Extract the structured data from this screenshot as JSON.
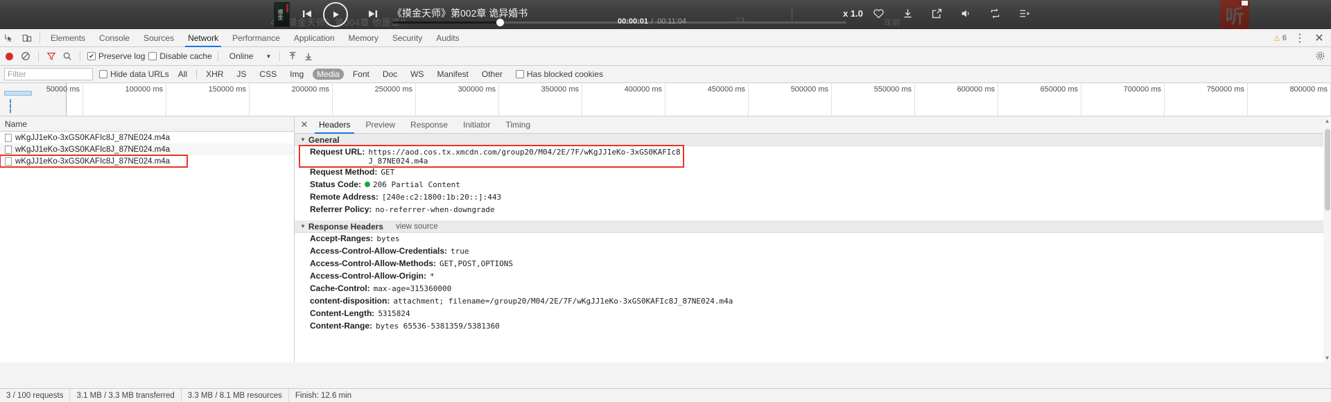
{
  "player": {
    "track_title": "《摸金天师》第002章 诡异婚书",
    "ghost_text": "4  《摸金天师》第004章 他是谁?",
    "ghost_text_2": "23",
    "ghost_text_3": "年前",
    "album_art_text": "摸金",
    "time_current": "00:00:01",
    "time_separator": "/",
    "time_duration": "00:11:04",
    "speed": "x 1.0",
    "icons": [
      "prev-icon",
      "play-icon",
      "next-icon",
      "heart-icon",
      "download-icon",
      "share-icon",
      "volume-icon",
      "repeat-icon",
      "playlist-icon"
    ],
    "logo_glyph": "听"
  },
  "devtools": {
    "tabs": [
      {
        "label": "Elements",
        "active": false
      },
      {
        "label": "Console",
        "active": false
      },
      {
        "label": "Sources",
        "active": false
      },
      {
        "label": "Network",
        "active": true
      },
      {
        "label": "Performance",
        "active": false
      },
      {
        "label": "Application",
        "active": false
      },
      {
        "label": "Memory",
        "active": false
      },
      {
        "label": "Security",
        "active": false
      },
      {
        "label": "Audits",
        "active": false
      }
    ],
    "warning_count": "6",
    "warning_icon": "⚠",
    "more_icon": "⋮",
    "close_icon": "✕"
  },
  "network_toolbar": {
    "preserve_log_label": "Preserve log",
    "preserve_log_checked": true,
    "disable_cache_label": "Disable cache",
    "disable_cache_checked": false,
    "throttling_value": "Online",
    "throttling_caret": "▼",
    "settings_icon": "gear-icon"
  },
  "filter_bar": {
    "placeholder": "Filter",
    "value": "",
    "hide_data_urls_label": "Hide data URLs",
    "hide_data_urls_checked": false,
    "types": [
      {
        "label": "All",
        "selected": false
      },
      {
        "label": "XHR",
        "selected": false
      },
      {
        "label": "JS",
        "selected": false
      },
      {
        "label": "CSS",
        "selected": false
      },
      {
        "label": "Img",
        "selected": false
      },
      {
        "label": "Media",
        "selected": true
      },
      {
        "label": "Font",
        "selected": false
      },
      {
        "label": "Doc",
        "selected": false
      },
      {
        "label": "WS",
        "selected": false
      },
      {
        "label": "Manifest",
        "selected": false
      },
      {
        "label": "Other",
        "selected": false
      }
    ],
    "has_blocked_cookies_label": "Has blocked cookies",
    "has_blocked_cookies_checked": false
  },
  "timeline": {
    "ticks": [
      "50000 ms",
      "100000 ms",
      "150000 ms",
      "200000 ms",
      "250000 ms",
      "300000 ms",
      "350000 ms",
      "400000 ms",
      "450000 ms",
      "500000 ms",
      "550000 ms",
      "600000 ms",
      "650000 ms",
      "700000 ms",
      "750000 ms",
      "800000 ms"
    ]
  },
  "requests": {
    "column_header": "Name",
    "rows": [
      {
        "name": "wKgJJ1eKo-3xGS0KAFIc8J_87NE024.m4a",
        "highlight": false
      },
      {
        "name": "wKgJJ1eKo-3xGS0KAFIc8J_87NE024.m4a",
        "highlight": false
      },
      {
        "name": "wKgJJ1eKo-3xGS0KAFIc8J_87NE024.m4a",
        "highlight": true
      }
    ]
  },
  "details": {
    "tabs": [
      {
        "label": "Headers",
        "active": true
      },
      {
        "label": "Preview",
        "active": false
      },
      {
        "label": "Response",
        "active": false
      },
      {
        "label": "Initiator",
        "active": false
      },
      {
        "label": "Timing",
        "active": false
      }
    ],
    "general_title": "General",
    "general": [
      {
        "key": "Request URL:",
        "value": "https://aod.cos.tx.xmcdn.com/group20/M04/2E/7F/wKgJJ1eKo-3xGS0KAFIc8J_87NE024.m4a",
        "boxed": true
      },
      {
        "key": "Request Method:",
        "value": "GET",
        "boxed": false
      },
      {
        "key": "Status Code:",
        "value": "206 Partial Content",
        "boxed": false,
        "status_dot": true
      },
      {
        "key": "Remote Address:",
        "value": "[240e:c2:1800:1b:20::]:443",
        "boxed": false
      },
      {
        "key": "Referrer Policy:",
        "value": "no-referrer-when-downgrade",
        "boxed": false
      }
    ],
    "response_title": "Response Headers",
    "view_source": "view source",
    "response": [
      {
        "key": "Accept-Ranges:",
        "value": "bytes"
      },
      {
        "key": "Access-Control-Allow-Credentials:",
        "value": "true"
      },
      {
        "key": "Access-Control-Allow-Methods:",
        "value": "GET,POST,OPTIONS"
      },
      {
        "key": "Access-Control-Allow-Origin:",
        "value": "*"
      },
      {
        "key": "Cache-Control:",
        "value": "max-age=315360000"
      },
      {
        "key": "content-disposition:",
        "value": "attachment; filename=/group20/M04/2E/7F/wKgJJ1eKo-3xGS0KAFIc8J_87NE024.m4a"
      },
      {
        "key": "Content-Length:",
        "value": "5315824"
      },
      {
        "key": "Content-Range:",
        "value": "bytes 65536-5381359/5381360"
      }
    ]
  },
  "status_bar": {
    "requests": "3 / 100 requests",
    "transferred": "3.1 MB / 3.3 MB transferred",
    "resources": "3.3 MB / 8.1 MB resources",
    "finish": "Finish: 12.6 min"
  }
}
